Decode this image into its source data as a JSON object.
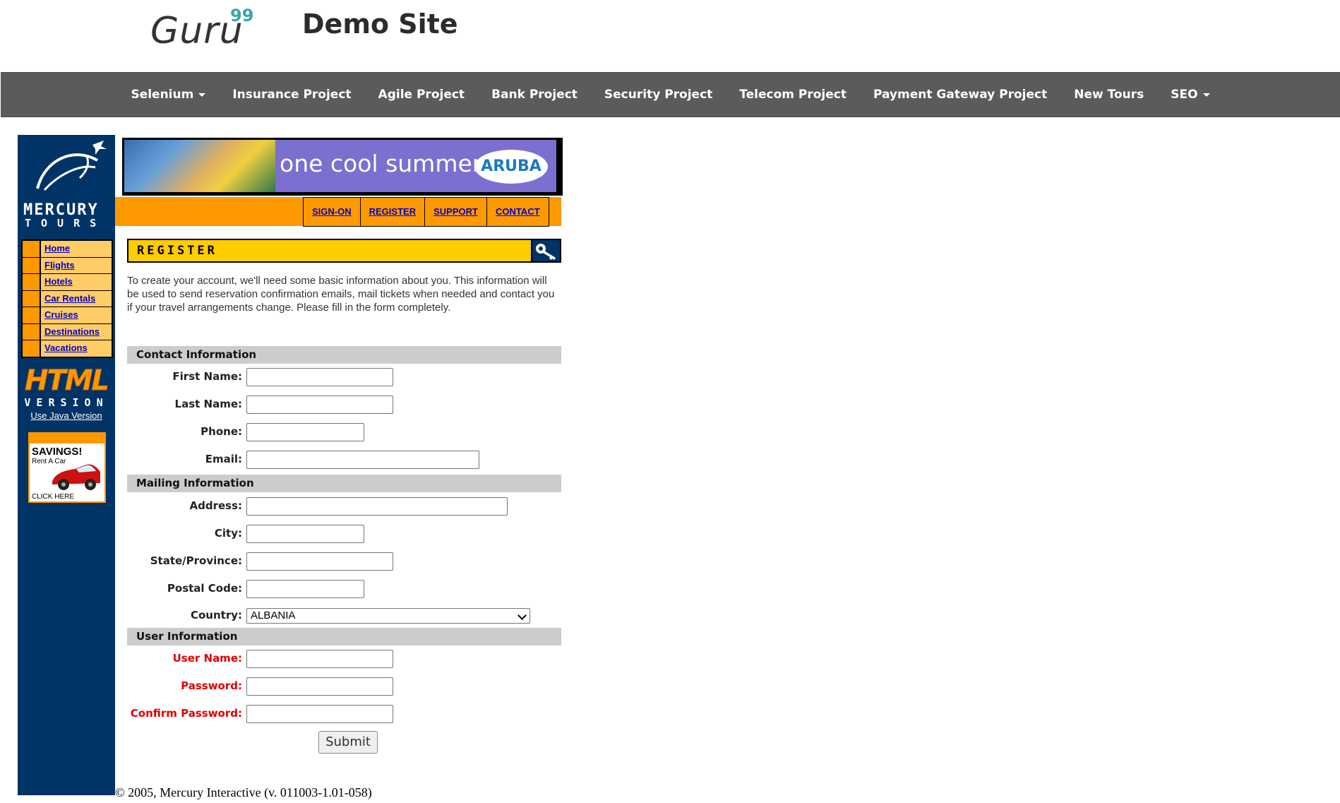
{
  "header": {
    "brand_text": "Guru",
    "brand_superscript": "99",
    "site_title": "Demo Site"
  },
  "topnav": {
    "items": [
      {
        "label": "Selenium",
        "dropdown": true
      },
      {
        "label": "Insurance Project",
        "dropdown": false
      },
      {
        "label": "Agile Project",
        "dropdown": false
      },
      {
        "label": "Bank Project",
        "dropdown": false
      },
      {
        "label": "Security Project",
        "dropdown": false
      },
      {
        "label": "Telecom Project",
        "dropdown": false
      },
      {
        "label": "Payment Gateway Project",
        "dropdown": false
      },
      {
        "label": "New Tours",
        "dropdown": false
      },
      {
        "label": "SEO",
        "dropdown": true
      }
    ]
  },
  "mercury": {
    "logo_line1": "MERCURY",
    "logo_line2": "TOURS",
    "banner_slogan": "one cool summer",
    "banner_brand": "ARUBA",
    "top_links": [
      "SIGN-ON",
      "REGISTER",
      "SUPPORT",
      "CONTACT"
    ],
    "side_menu": [
      "Home",
      "Flights",
      "Hotels",
      "Car Rentals",
      "Cruises",
      "Destinations",
      "Vacations"
    ],
    "html_version_big": "HTML",
    "html_version_small": "VERSION",
    "java_link": "Use Java Version",
    "savings_title": "SAVINGS!",
    "savings_sub": "Rent A Car",
    "savings_cta": "CLICK HERE"
  },
  "form": {
    "title": "REGISTER",
    "intro": "To create your account, we'll need some basic information about you. This information will be used to send reservation confirmation emails, mail tickets when needed and contact you if your travel arrangements change. Please fill in the form completely.",
    "sections": {
      "contact": "Contact Information",
      "mailing": "Mailing Information",
      "user": "User Information"
    },
    "labels": {
      "first_name": "First Name:",
      "last_name": "Last Name:",
      "phone": "Phone:",
      "email": "Email:",
      "address": "Address:",
      "city": "City:",
      "state": "State/Province:",
      "postal": "Postal Code:",
      "country": "Country:",
      "user_name": "User Name:",
      "password": "Password:",
      "confirm_password": "Confirm Password:"
    },
    "values": {
      "first_name": "",
      "last_name": "",
      "phone": "",
      "email": "",
      "address": "",
      "city": "",
      "state": "",
      "postal": "",
      "country": "ALBANIA",
      "user_name": "",
      "password": "",
      "confirm_password": ""
    },
    "submit_label": "Submit"
  },
  "footer": {
    "copyright": "© 2005, Mercury Interactive (v. 011003-1.01-058)"
  },
  "colors": {
    "nav_bg": "#5b5b5b",
    "mercury_blue": "#003366",
    "orange": "#ff9900",
    "yellow": "#ffcc00",
    "link_blue": "#0000cc",
    "required_red": "#e00000"
  }
}
